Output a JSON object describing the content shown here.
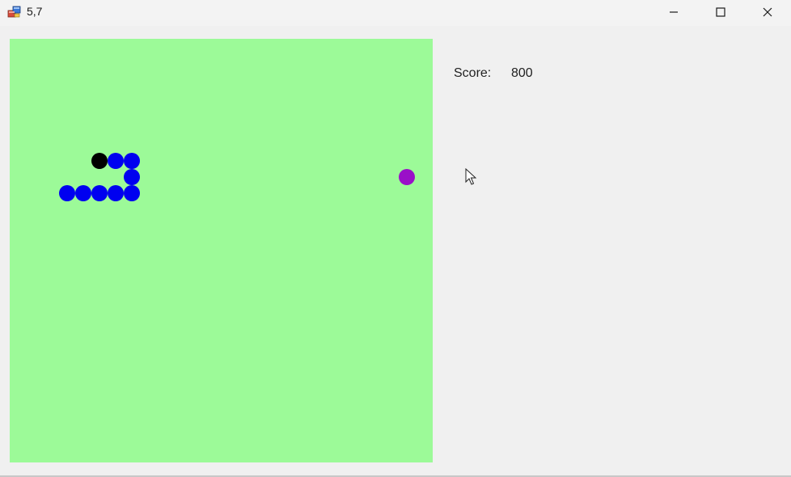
{
  "window": {
    "title": "5,7"
  },
  "controls": {
    "minimize_icon": "minimize-icon",
    "maximize_icon": "maximize-icon",
    "close_icon": "close-icon"
  },
  "score": {
    "label": "Score:",
    "value": "800"
  },
  "colors": {
    "board": "#9cfa98",
    "snake_body": "#0000f0",
    "snake_head": "#000000",
    "food": "#9a10c8",
    "window_bg": "#f0f0f0"
  },
  "game": {
    "grid_cell_count": 26,
    "snake": [
      {
        "col": 5,
        "row": 7,
        "part": "head"
      },
      {
        "col": 6,
        "row": 7,
        "part": "body"
      },
      {
        "col": 7,
        "row": 7,
        "part": "body"
      },
      {
        "col": 7,
        "row": 8,
        "part": "body"
      },
      {
        "col": 7,
        "row": 9,
        "part": "body"
      },
      {
        "col": 6,
        "row": 9,
        "part": "body"
      },
      {
        "col": 5,
        "row": 9,
        "part": "body"
      },
      {
        "col": 4,
        "row": 9,
        "part": "body"
      },
      {
        "col": 3,
        "row": 9,
        "part": "body"
      }
    ],
    "food": {
      "col": 24,
      "row": 8
    }
  }
}
